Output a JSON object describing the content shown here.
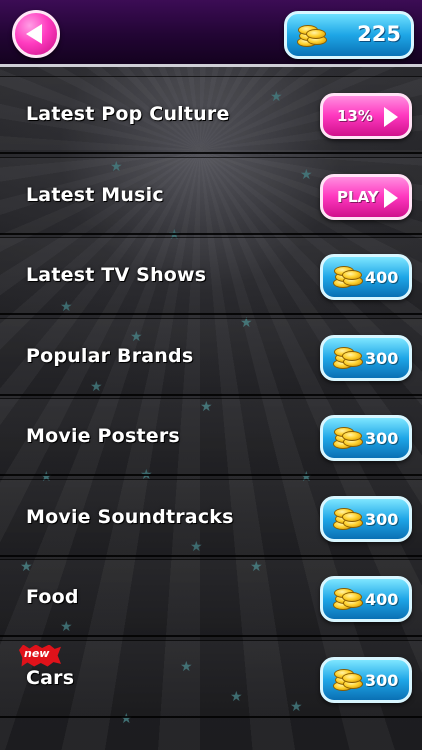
{
  "header": {
    "coins": "225"
  },
  "categories": [
    {
      "title": "Latest Pop Culture",
      "button_type": "progress",
      "button_text": "13%"
    },
    {
      "title": "Latest Music",
      "button_type": "play",
      "button_text": "PLAY"
    },
    {
      "title": "Latest TV Shows",
      "button_type": "price",
      "button_text": "400"
    },
    {
      "title": "Popular Brands",
      "button_type": "price",
      "button_text": "300"
    },
    {
      "title": "Movie Posters",
      "button_type": "price",
      "button_text": "300"
    },
    {
      "title": "Movie Soundtracks",
      "button_type": "price",
      "button_text": "300"
    },
    {
      "title": "Food",
      "button_type": "price",
      "button_text": "400"
    },
    {
      "title": "Cars",
      "button_type": "price",
      "button_text": "300",
      "badge": "new"
    }
  ],
  "icons": {
    "back": "back-arrow-icon",
    "coins": "coin-stack-icon",
    "play": "play-triangle-icon"
  },
  "colors": {
    "header_top": "#3c0c55",
    "pink_button": "#ff39c0",
    "blue_button": "#1fa6e7",
    "badge_red": "#e0121a"
  }
}
